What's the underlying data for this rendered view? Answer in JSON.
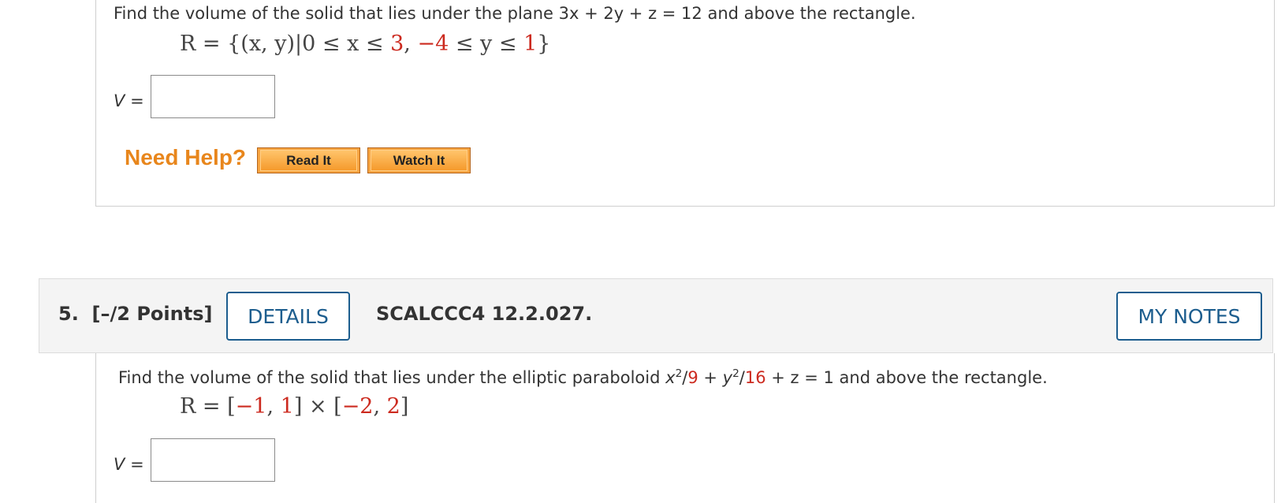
{
  "q4": {
    "prompt": "Find the volume of the solid that lies under the plane 3x + 2y + z = 12 and above the rectangle.",
    "region": {
      "lhs": "R = {(x, y)|0 ≤ x ≤ ",
      "x_max": "3",
      "mid": ", ",
      "y_min": "−4",
      "mid2": " ≤ y ≤ ",
      "y_max": "1",
      "end": "}"
    },
    "answer_label": "V",
    "answer_equals": "=",
    "answer_value": "",
    "need_help": "Need Help?",
    "read_it": "Read It",
    "watch_it": "Watch It"
  },
  "q5": {
    "number": "5.",
    "points": "[–/2 Points]",
    "details": "DETAILS",
    "code": "SCALCCC4 12.2.027.",
    "my_notes": "MY NOTES",
    "prompt_start": "Find the volume of the solid that lies under the elliptic paraboloid ",
    "x_var": "x",
    "x_exp": "2",
    "x_den": "9",
    "plus1": " + ",
    "y_var": "y",
    "y_exp": "2",
    "y_den": "16",
    "prompt_end": " + z = 1 and above the rectangle.",
    "region": {
      "lhs": "R = [",
      "a": "−1",
      "comma1": ", ",
      "b": "1",
      "times": "] × [",
      "c": "−2",
      "comma2": ", ",
      "d": "2",
      "end": "]"
    },
    "answer_label": "V",
    "answer_equals": "=",
    "answer_value": ""
  },
  "colors": {
    "link_blue": "#1c5d8e",
    "help_orange": "#e8861c",
    "highlight_red": "#cc2a1f"
  }
}
